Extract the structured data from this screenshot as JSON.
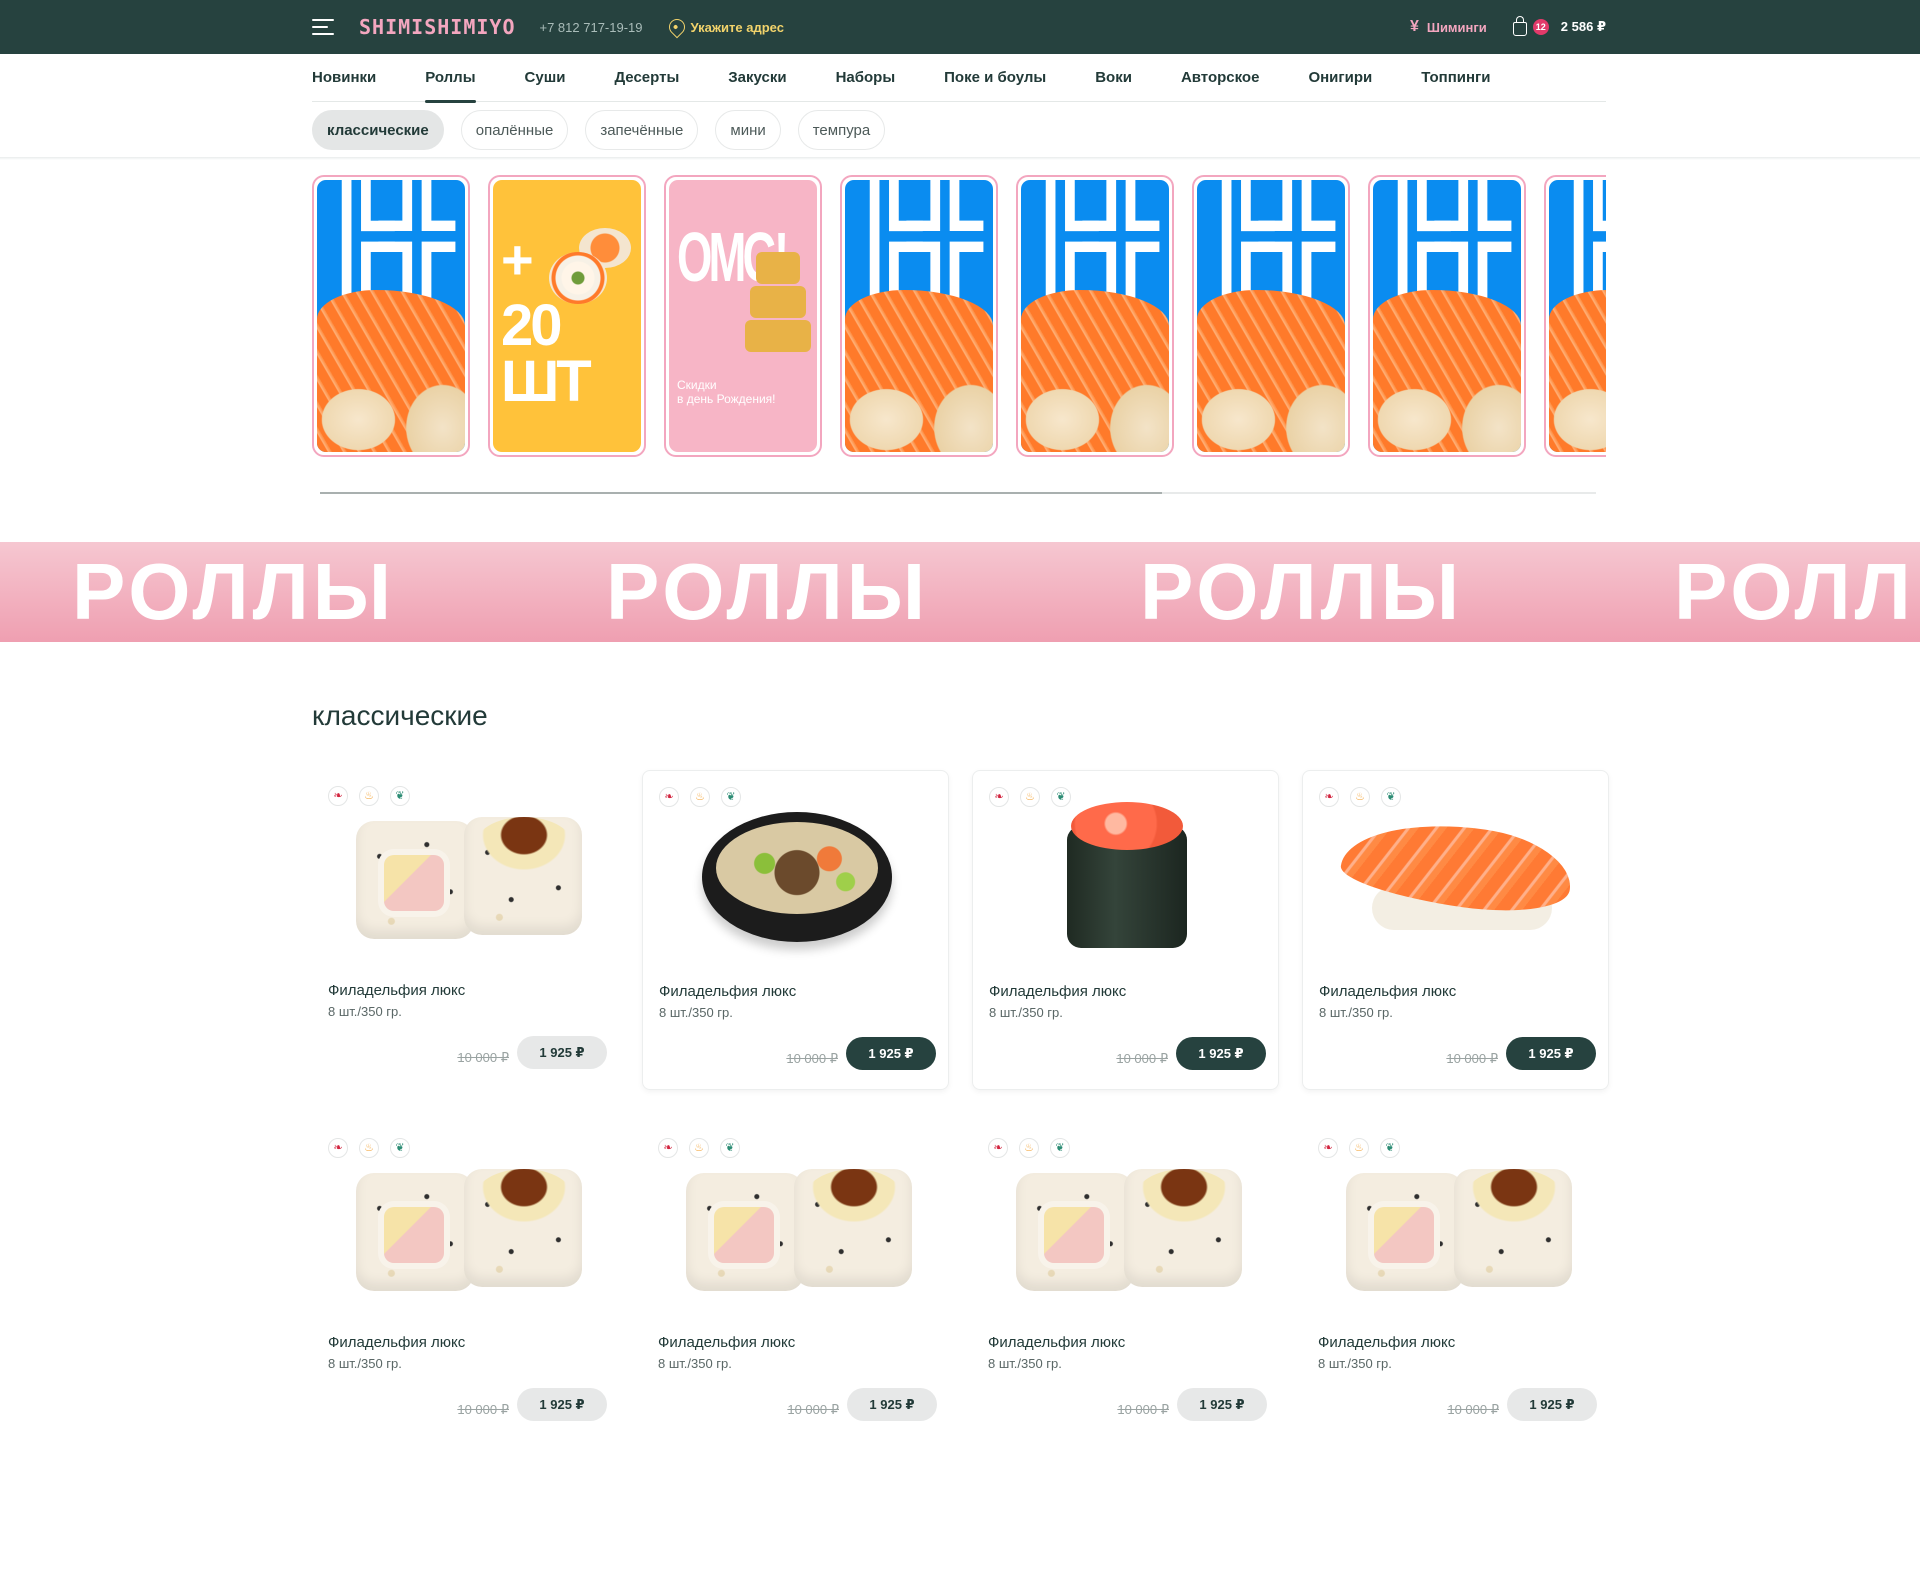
{
  "header": {
    "logo": "SHIMISHIMIYO",
    "phone": "+7 812 717-19-19",
    "address_prompt": "Укажите адрес",
    "loyalty_label": "Шиминги",
    "cart_count": "12",
    "cart_total": "2 586 ₽"
  },
  "categories": [
    "Новинки",
    "Роллы",
    "Суши",
    "Десерты",
    "Закуски",
    "Наборы",
    "Поке и боулы",
    "Воки",
    "Авторское",
    "Онигири",
    "Топпинги"
  ],
  "active_category": "Роллы",
  "subcategories": [
    "классические",
    "опалённые",
    "запечённые",
    "мини",
    "темпура"
  ],
  "active_subcategory": "классические",
  "stories": [
    {
      "kind": "blue",
      "caption": ""
    },
    {
      "kind": "yellow",
      "plus": "+",
      "big_text": "20 ШТ"
    },
    {
      "kind": "pink",
      "big_text": "OMG!",
      "text_line1": "Скидки",
      "text_line2": "в день Рождения!"
    },
    {
      "kind": "blue"
    },
    {
      "kind": "blue"
    },
    {
      "kind": "blue"
    },
    {
      "kind": "blue"
    },
    {
      "kind": "blue"
    }
  ],
  "stories_scroll_fraction": 0.66,
  "ribbon_word": "РОЛЛЫ",
  "section_title": "классические",
  "tag_icons": [
    "chili-icon",
    "fire-icon",
    "leaf-icon"
  ],
  "products": [
    {
      "name": "Филадельфия люкс",
      "weight": "8 шт./350 гр.",
      "old_price": "10 000 ₽",
      "price": "1 925 ₽",
      "image": "rolls",
      "highlighted": false
    },
    {
      "name": "Филадельфия люкс",
      "weight": "8 шт./350 гр.",
      "old_price": "10 000 ₽",
      "price": "1 925 ₽",
      "image": "bowl",
      "highlighted": true
    },
    {
      "name": "Филадельфия люкс",
      "weight": "8 шт./350 гр.",
      "old_price": "10 000 ₽",
      "price": "1 925 ₽",
      "image": "gunkan",
      "highlighted": true
    },
    {
      "name": "Филадельфия люкс",
      "weight": "8 шт./350 гр.",
      "old_price": "10 000 ₽",
      "price": "1 925 ₽",
      "image": "nigiri",
      "highlighted": true
    },
    {
      "name": "Филадельфия люкс",
      "weight": "8 шт./350 гр.",
      "old_price": "10 000 ₽",
      "price": "1 925 ₽",
      "image": "rolls",
      "highlighted": false
    },
    {
      "name": "Филадельфия люкс",
      "weight": "8 шт./350 гр.",
      "old_price": "10 000 ₽",
      "price": "1 925 ₽",
      "image": "rolls",
      "highlighted": false
    },
    {
      "name": "Филадельфия люкс",
      "weight": "8 шт./350 гр.",
      "old_price": "10 000 ₽",
      "price": "1 925 ₽",
      "image": "rolls",
      "highlighted": false
    },
    {
      "name": "Филадельфия люкс",
      "weight": "8 шт./350 гр.",
      "old_price": "10 000 ₽",
      "price": "1 925 ₽",
      "image": "rolls",
      "highlighted": false
    }
  ],
  "colors": {
    "header_bg": "#26423f",
    "accent_pink": "#f3a6bf",
    "address_yellow": "#f2d36b",
    "badge_red": "#e23a6a"
  }
}
